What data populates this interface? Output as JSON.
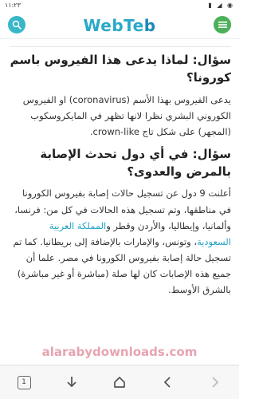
{
  "status_bar": {
    "time": "١١:٢٣",
    "icons": "▮ ◢ ◉"
  },
  "header": {
    "logo_main": "WebTe",
    "logo_tail": "b"
  },
  "article": {
    "q1": "سؤال: لماذا يدعى هذا الفيروس باسم كورونا؟",
    "a1": "يدعى الفيروس بهذا الأسم (coronavirus) او الفيروس الكوروني البشري نظرا لانها تظهر في المايكروسكوب (المجهر) على شكل تاج crown-like.",
    "q2": "سؤال: في أي دول تحدث الإصابة بالمرض والعدوى؟",
    "a2_part1": "أعلنت 9 دول عن تسجيل حالات إصابة بفيروس الكورونا في مناطقها، وتم تسجيل هذه الحالات في كل من: فرنسا، وألمانيا، وإيطاليا، والأردن وقطر و",
    "a2_link": "المملكة العربية السعودية",
    "a2_part2": "، وتونس، والإمارات بالإضافة إلى بريطانيا. كما تم تسجيل حالة إصابة بفيروس الكورونا في مصر. علما أن جميع هذه الإصابات كان لها صلة (مباشرة أو غير مباشرة) بالشرق الأوسط."
  },
  "watermark": "alarabydownloads.com",
  "bottom_nav": {
    "tab_count": "1"
  },
  "colors": {
    "search": "#39b6c8",
    "menu": "#4cb05a",
    "logo": "#2aa9c9",
    "link": "#1fa3c6"
  }
}
